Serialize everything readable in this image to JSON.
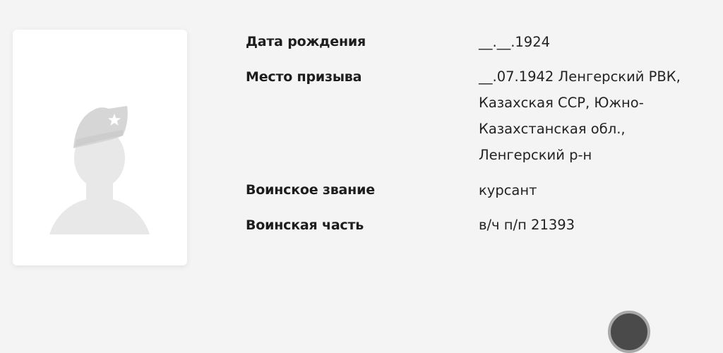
{
  "photo": {
    "icon": "soldier-silhouette-icon"
  },
  "details": {
    "birth_date": {
      "label": "Дата рождения",
      "value": "__.__.1924"
    },
    "conscription_place": {
      "label": "Место призыва",
      "value_lines": [
        "__.07.1942 Ленгерский РВК,",
        "Казахская ССР, Южно-",
        "Казахстанская обл.,",
        "Ленгерский р-н"
      ]
    },
    "military_rank": {
      "label": "Воинское звание",
      "value": "курсант"
    },
    "military_unit": {
      "label": "Воинская часть",
      "value": "в/ч п/п 21393"
    }
  },
  "colors": {
    "background": "#f4f4f4",
    "card": "#ffffff",
    "silhouette": "#e8e8e8",
    "text": "#1f1f1f",
    "button": "#4a4a4a"
  },
  "scroll_button": {
    "icon": "scroll-up-icon"
  }
}
